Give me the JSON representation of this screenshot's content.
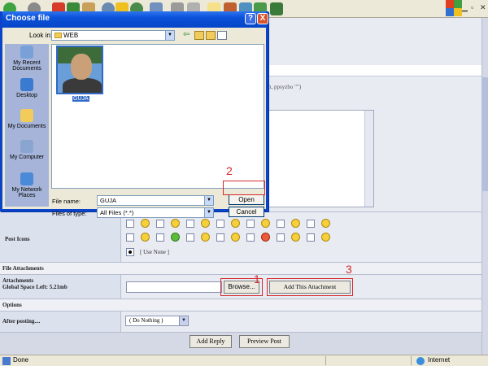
{
  "dialog": {
    "title": "Choose file",
    "help": "?",
    "close": "X",
    "look_in_label": "Look in:",
    "look_in_value": "WEB",
    "places": [
      {
        "label": "My Recent Documents"
      },
      {
        "label": "Desktop"
      },
      {
        "label": "My Documents"
      },
      {
        "label": "My Computer"
      },
      {
        "label": "My Network Places"
      }
    ],
    "files": [
      {
        "name": "GUJA"
      }
    ],
    "file_name_label": "File name:",
    "file_name_value": "GUJA",
    "file_type_label": "Files of type:",
    "file_type_value": "All Files (*.*)",
    "open_label": "Open",
    "cancel_label": "Cancel"
  },
  "form": {
    "post_icons_label": "Post Icons",
    "use_none_label": "[ Use None ]",
    "file_attachments_heading": "File Attachments",
    "attachments_label": "Attachments",
    "space_left_label": "Global Space Left: 5.21mb",
    "browse_label": "Browse...",
    "add_attachment_label": "Add This Attachment",
    "options_heading": "Options",
    "after_posting_label": "After posting....",
    "after_posting_value": "( Do Nothing )",
    "add_reply_label": "Add Reply",
    "preview_post_label": "Preview Post",
    "background_fragment": "h, ppsyzbo \"\")"
  },
  "annotations": {
    "step1": "1",
    "step2": "2",
    "step3": "3",
    "color": "#d42a2a"
  },
  "status": {
    "left": "Done",
    "zone": "Internet"
  }
}
